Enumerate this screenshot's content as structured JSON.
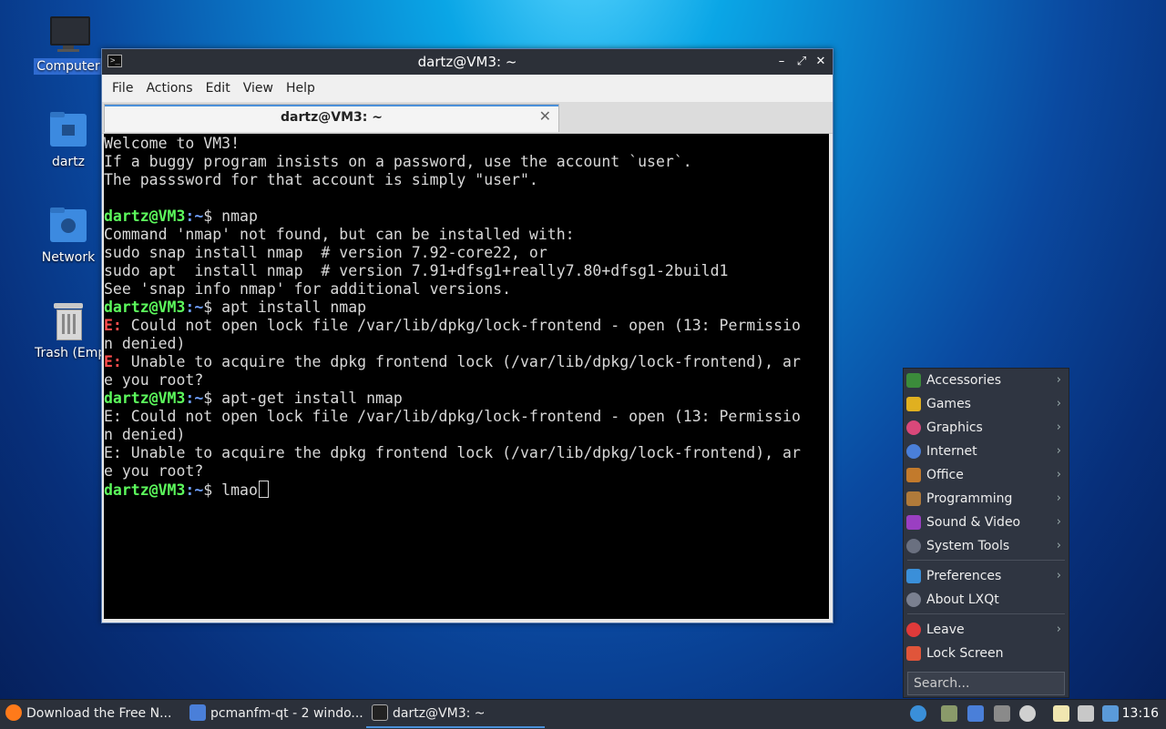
{
  "desktop": {
    "icons": [
      {
        "label": "Computer",
        "icon": "monitor-icon",
        "selected": true
      },
      {
        "label": "dartz",
        "icon": "home-folder-icon"
      },
      {
        "label": "Network",
        "icon": "network-folder-icon"
      },
      {
        "label": "Trash (Empty)",
        "icon": "trash-icon"
      }
    ]
  },
  "window": {
    "title": "dartz@VM3: ~",
    "controls": {
      "minimize": "–",
      "maximize": "⤢",
      "close": "✕"
    },
    "menu": [
      "File",
      "Actions",
      "Edit",
      "View",
      "Help"
    ],
    "tab": {
      "title": "dartz@VM3: ~",
      "close": "✕"
    }
  },
  "terminal": {
    "prompt_user": "dartz@VM3",
    "prompt_path": ":~",
    "prompt_end": "$ ",
    "lines": {
      "l1": "Welcome to VM3!",
      "l2": "If a buggy program insists on a password, use the account `user`.",
      "l3": "The passsword for that account is simply \"user\".",
      "cmd1": "nmap",
      "l5": "Command 'nmap' not found, but can be installed with:",
      "l6": "sudo snap install nmap  # version 7.92-core22, or",
      "l7": "sudo apt  install nmap  # version 7.91+dfsg1+really7.80+dfsg1-2build1",
      "l8": "See 'snap info nmap' for additional versions.",
      "cmd2": "apt install nmap",
      "e_tag": "E:",
      "l10": " Could not open lock file /var/lib/dpkg/lock-frontend - open (13: Permissio",
      "l11": "n denied)",
      "l12": " Unable to acquire the dpkg frontend lock (/var/lib/dpkg/lock-frontend), ar",
      "l13": "e you root?",
      "cmd3": "apt-get install nmap",
      "l15": "E: Could not open lock file /var/lib/dpkg/lock-frontend - open (13: Permissio",
      "l16": "n denied)",
      "l17": "E: Unable to acquire the dpkg frontend lock (/var/lib/dpkg/lock-frontend), ar",
      "l18": "e you root?",
      "cmd4": "lmao"
    }
  },
  "startmenu": {
    "categories": [
      {
        "label": "Accessories",
        "icon": "accessories-icon",
        "color": "#3b8b3b"
      },
      {
        "label": "Games",
        "icon": "games-icon",
        "color": "#e0b020"
      },
      {
        "label": "Graphics",
        "icon": "graphics-icon",
        "color": "#d9487a"
      },
      {
        "label": "Internet",
        "icon": "internet-icon",
        "color": "#4a7fd9"
      },
      {
        "label": "Office",
        "icon": "office-icon",
        "color": "#c27a2c"
      },
      {
        "label": "Programming",
        "icon": "programming-icon",
        "color": "#b07a3a"
      },
      {
        "label": "Sound & Video",
        "icon": "sound-video-icon",
        "color": "#9a3fc2"
      },
      {
        "label": "System Tools",
        "icon": "system-tools-icon",
        "color": "#6a7080"
      }
    ],
    "settings": [
      {
        "label": "Preferences",
        "icon": "preferences-icon",
        "color": "#3a8fd9"
      },
      {
        "label": "About LXQt",
        "icon": "info-icon",
        "color": "#7a8090"
      }
    ],
    "session": [
      {
        "label": "Leave",
        "icon": "power-icon",
        "color": "#e03a3a"
      },
      {
        "label": "Lock Screen",
        "icon": "lock-icon",
        "color": "#e0553a"
      }
    ],
    "search_placeholder": "Search..."
  },
  "taskbar": {
    "tasks": [
      {
        "label": "Download the Free N...",
        "icon": "firefox-icon",
        "color": "#ff7a1a"
      },
      {
        "label": "pcmanfm-qt - 2 windo...",
        "icon": "folder-icon",
        "color": "#4a7fd9"
      },
      {
        "label": "dartz@VM3: ~",
        "icon": "terminal-icon",
        "color": "#222222"
      }
    ],
    "clock": "13:16"
  }
}
